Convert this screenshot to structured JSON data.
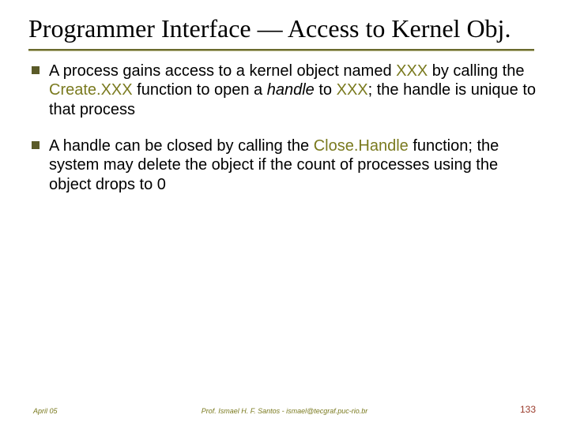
{
  "title": "Programmer Interface — Access to Kernel Obj.",
  "bullets": [
    {
      "pre": "A process gains access to a kernel object named ",
      "k1": "XXX",
      "mid1": " by calling the ",
      "f1": "Create.XXX",
      "mid2": " function to open a ",
      "i1": "handle",
      "mid3": " to ",
      "k2": "XXX",
      "post": "; the handle is unique to that process"
    },
    {
      "pre": "A handle can be closed by calling the ",
      "f1": "Close.Handle",
      "post": " function; the system may delete the object if the count of processes using the object drops to 0"
    }
  ],
  "footer": {
    "date": "April 05",
    "credit": "Prof. Ismael H. F. Santos  -  ismael@tecgraf.puc-rio.br",
    "page": "133"
  }
}
